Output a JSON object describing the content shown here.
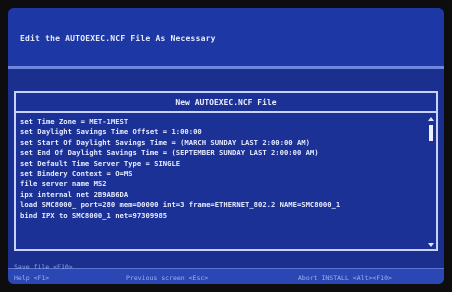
{
  "header": {
    "instruction": "Edit the AUTOEXEC.NCF File As Necessary"
  },
  "window": {
    "title": "New AUTOEXEC.NCF File",
    "lines": [
      "set Time Zone = MET-1MEST",
      "set Daylight Savings Time Offset = 1:00:00",
      "set Start Of Daylight Savings Time = (MARCH SUNDAY LAST  2:00:00 AM)",
      "set End Of Daylight Savings Time = (SEPTEMBER SUNDAY LAST  2:00:00 AM)",
      "set Default Time Server Type = SINGLE",
      "set Bindery Context = O=MS",
      "file server name MS2",
      "ipx internal net 2B9AB6DA",
      "load SMC8000_ port=280 mem=D0000 int=3 frame=ETHERNET_802.2 NAME=SMC8000_1",
      "bind IPX to SMC8000_1 net=97309985"
    ]
  },
  "footer": {
    "save": "Save file  <F10>",
    "help": "Help  <F1>",
    "previous": "Previous screen  <Esc>",
    "abort": "Abort INSTALL  <Alt><F10>"
  }
}
